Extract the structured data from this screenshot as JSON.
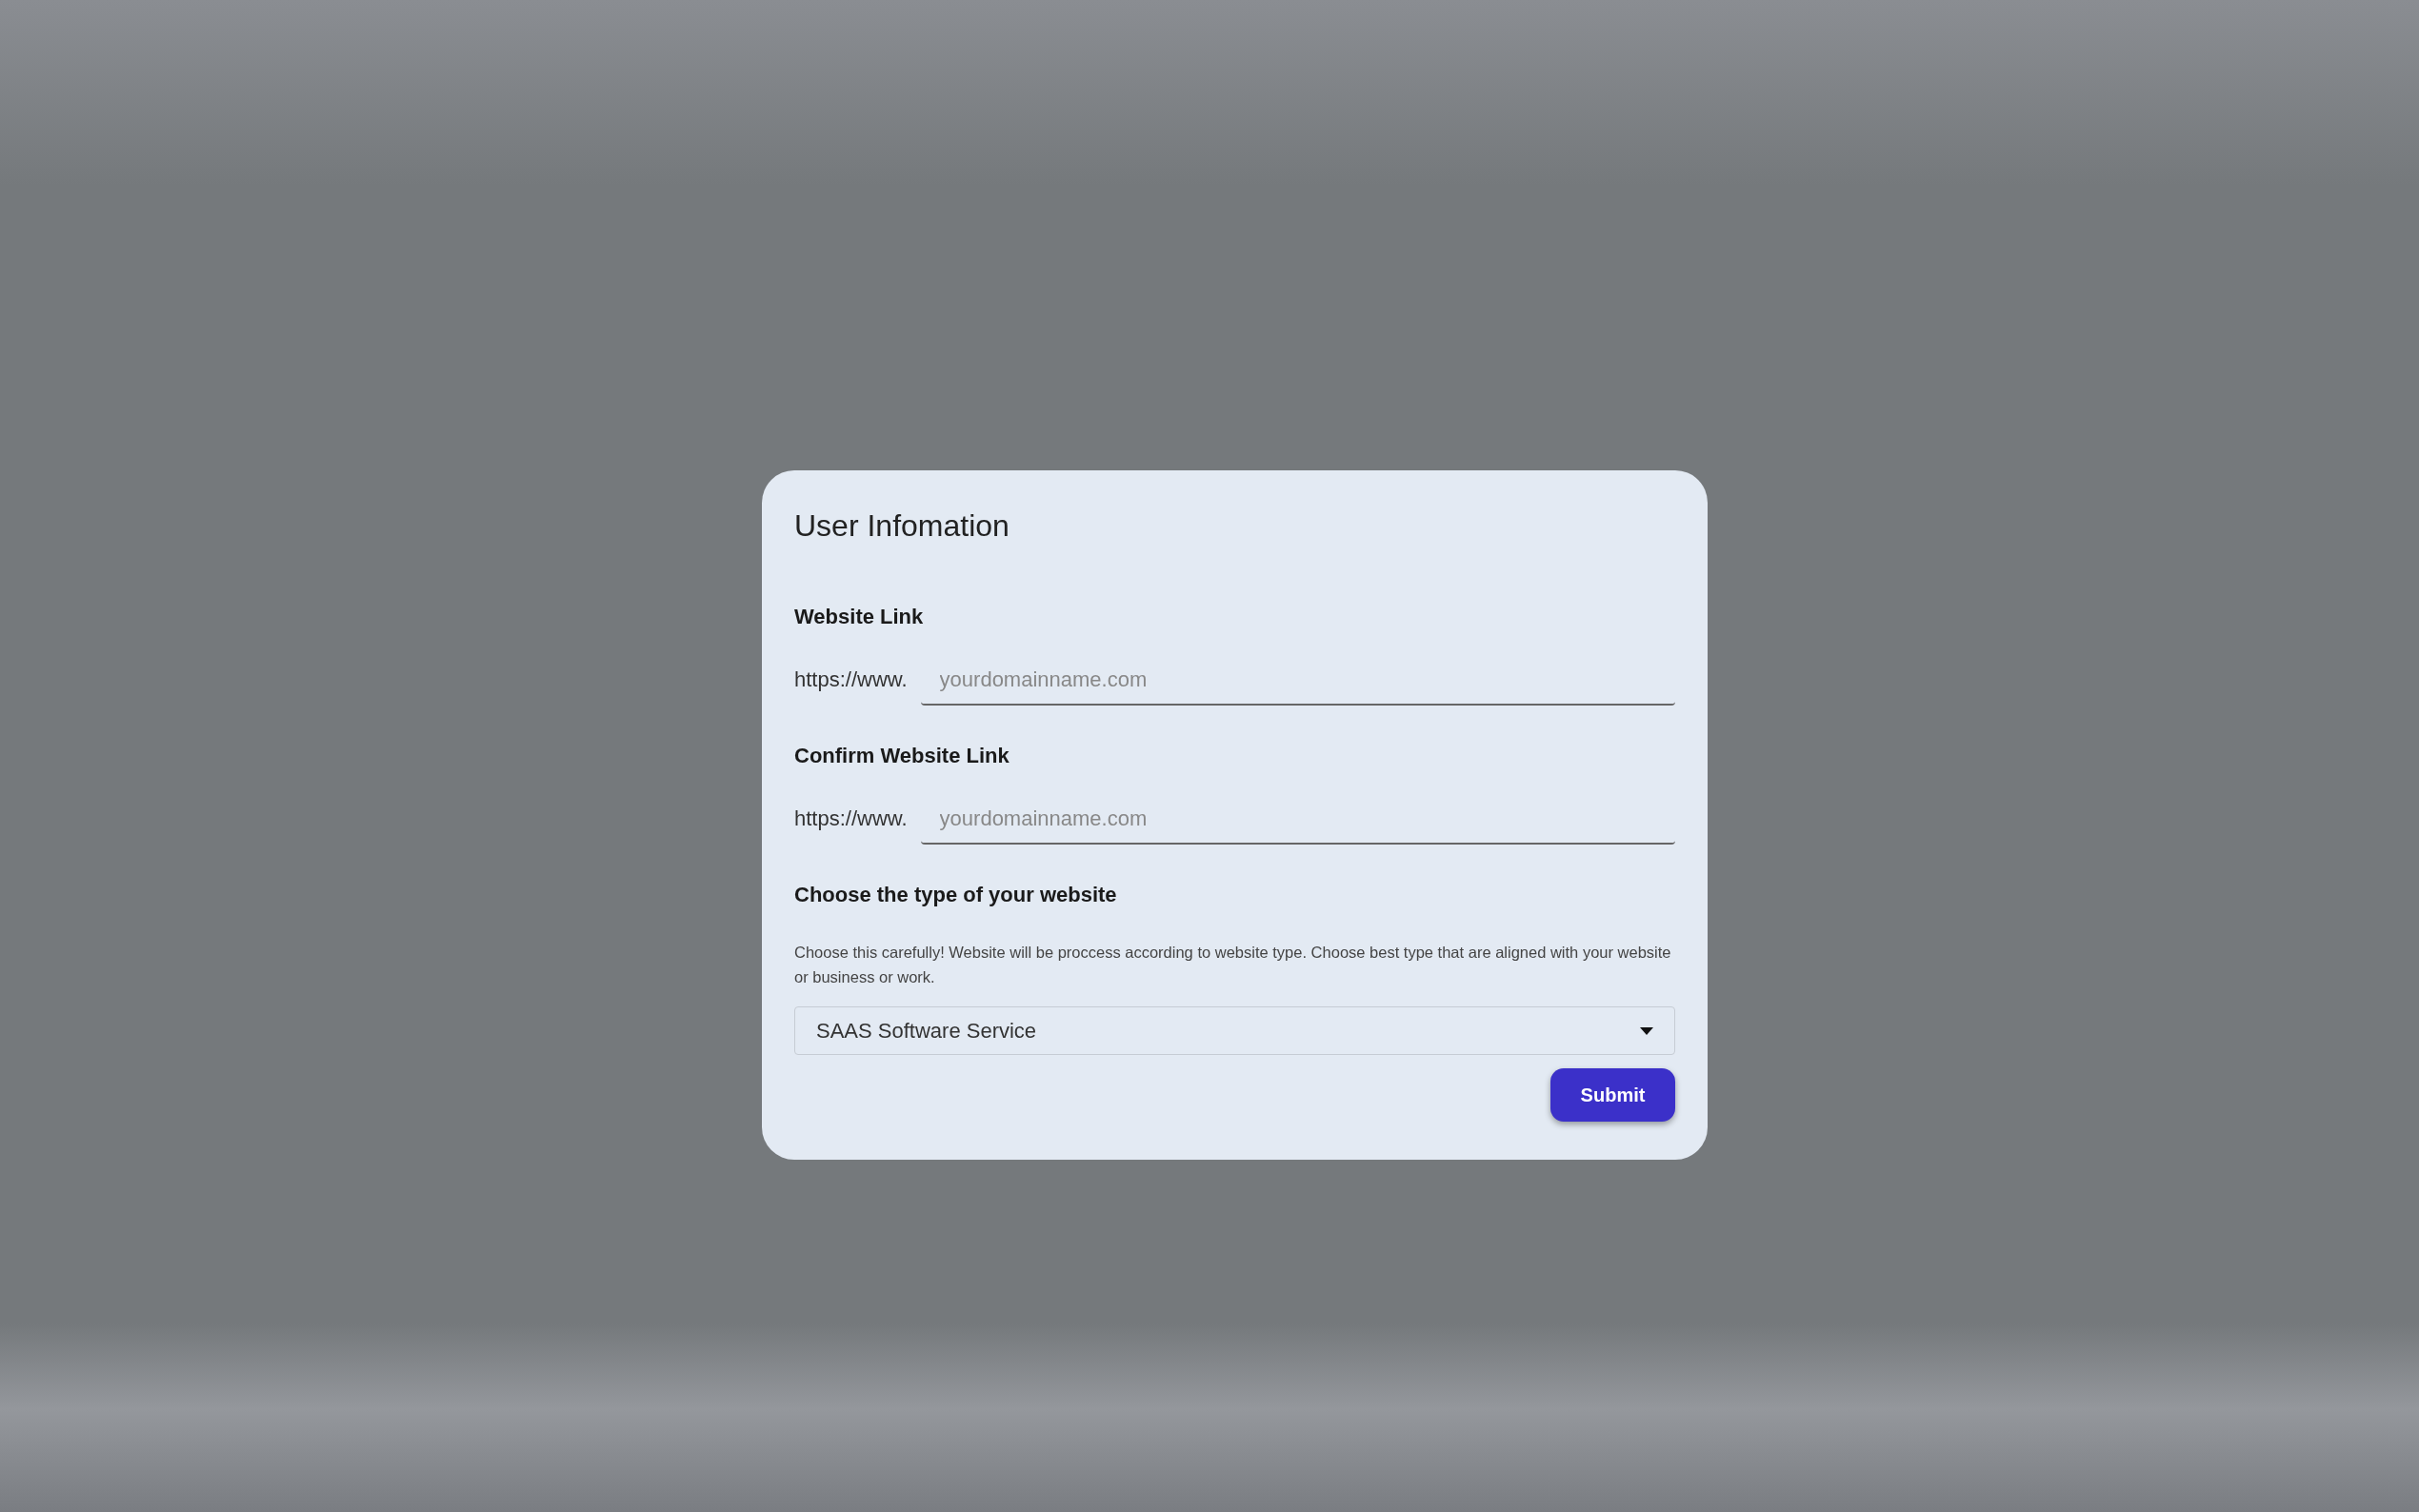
{
  "dialog": {
    "title": "User Infomation",
    "fields": [
      {
        "label": "Website Link",
        "prefix": "https://www.",
        "placeholder": "yourdomainname.com"
      },
      {
        "label": "Confirm Website Link",
        "prefix": "https://www.",
        "placeholder": "yourdomainname.com"
      }
    ],
    "type_select": {
      "label": "Choose the type of your website",
      "help": "Choose this carefully! Website will be proccess according to website type. Choose best type that are aligned with your website or business or work.",
      "value": "SAAS Software Service"
    },
    "submit": "Submit"
  }
}
